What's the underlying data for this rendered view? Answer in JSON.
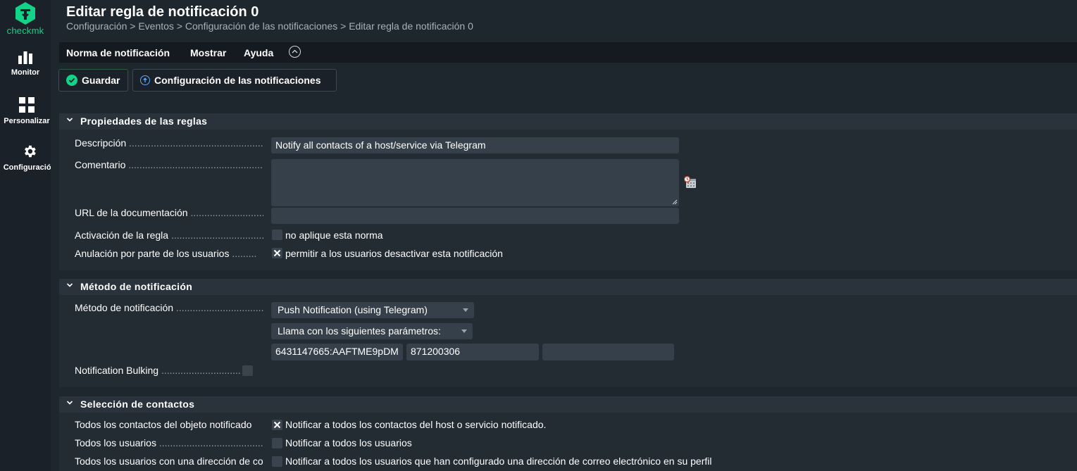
{
  "sidebar": {
    "logo_text": "checkmk",
    "items": [
      {
        "label": "Monitor",
        "icon": "bar-chart-icon"
      },
      {
        "label": "Personalizar",
        "icon": "grid-icon"
      },
      {
        "label": "Configuración",
        "icon": "gear-icon"
      }
    ]
  },
  "header": {
    "title": "Editar regla de notificación 0",
    "breadcrumb": "Configuración > Eventos > Configuración de las notificaciones > Editar regla de notificación 0"
  },
  "menubar": {
    "items": [
      "Norma de notificación",
      "Mostrar",
      "Ayuda"
    ]
  },
  "toolbar": {
    "save_label": "Guardar",
    "config_label": "Configuración de las notificaciones"
  },
  "section1": {
    "title": "Propiedades de las reglas",
    "description_label": "Descripción",
    "description_value": "Notify all contacts of a host/service via Telegram",
    "comment_label": "Comentario",
    "comment_value": "",
    "docurl_label": "URL de la documentación",
    "docurl_value": "",
    "activation_label": "Activación de la regla",
    "activation_text": "no aplique esta norma",
    "override_label": "Anulación por parte de los usuarios",
    "override_text": "permitir a los usuarios desactivar esta notificación"
  },
  "section2": {
    "title": "Método de notificación",
    "method_label": "Método de notificación",
    "method_value": "Push Notification (using Telegram)",
    "params_value": "Llama con los siguientes parámetros:",
    "param1": "6431147665:AAFTME9pDM",
    "param2": "871200306",
    "param3": "",
    "bulking_label": "Notification Bulking"
  },
  "section3": {
    "title": "Selección de contactos",
    "row1_label": "Todos los contactos del objeto notificado",
    "row1_text": "Notificar a todos los contactos del host o servicio notificado.",
    "row2_label": "Todos los usuarios",
    "row2_text": "Notificar a todos los usuarios",
    "row3_label": "Todos los usuarios con una dirección de correo electrónico",
    "row3_text": "Notificar a todos los usuarios que han configurado una dirección de correo electrónico en su perfil"
  }
}
